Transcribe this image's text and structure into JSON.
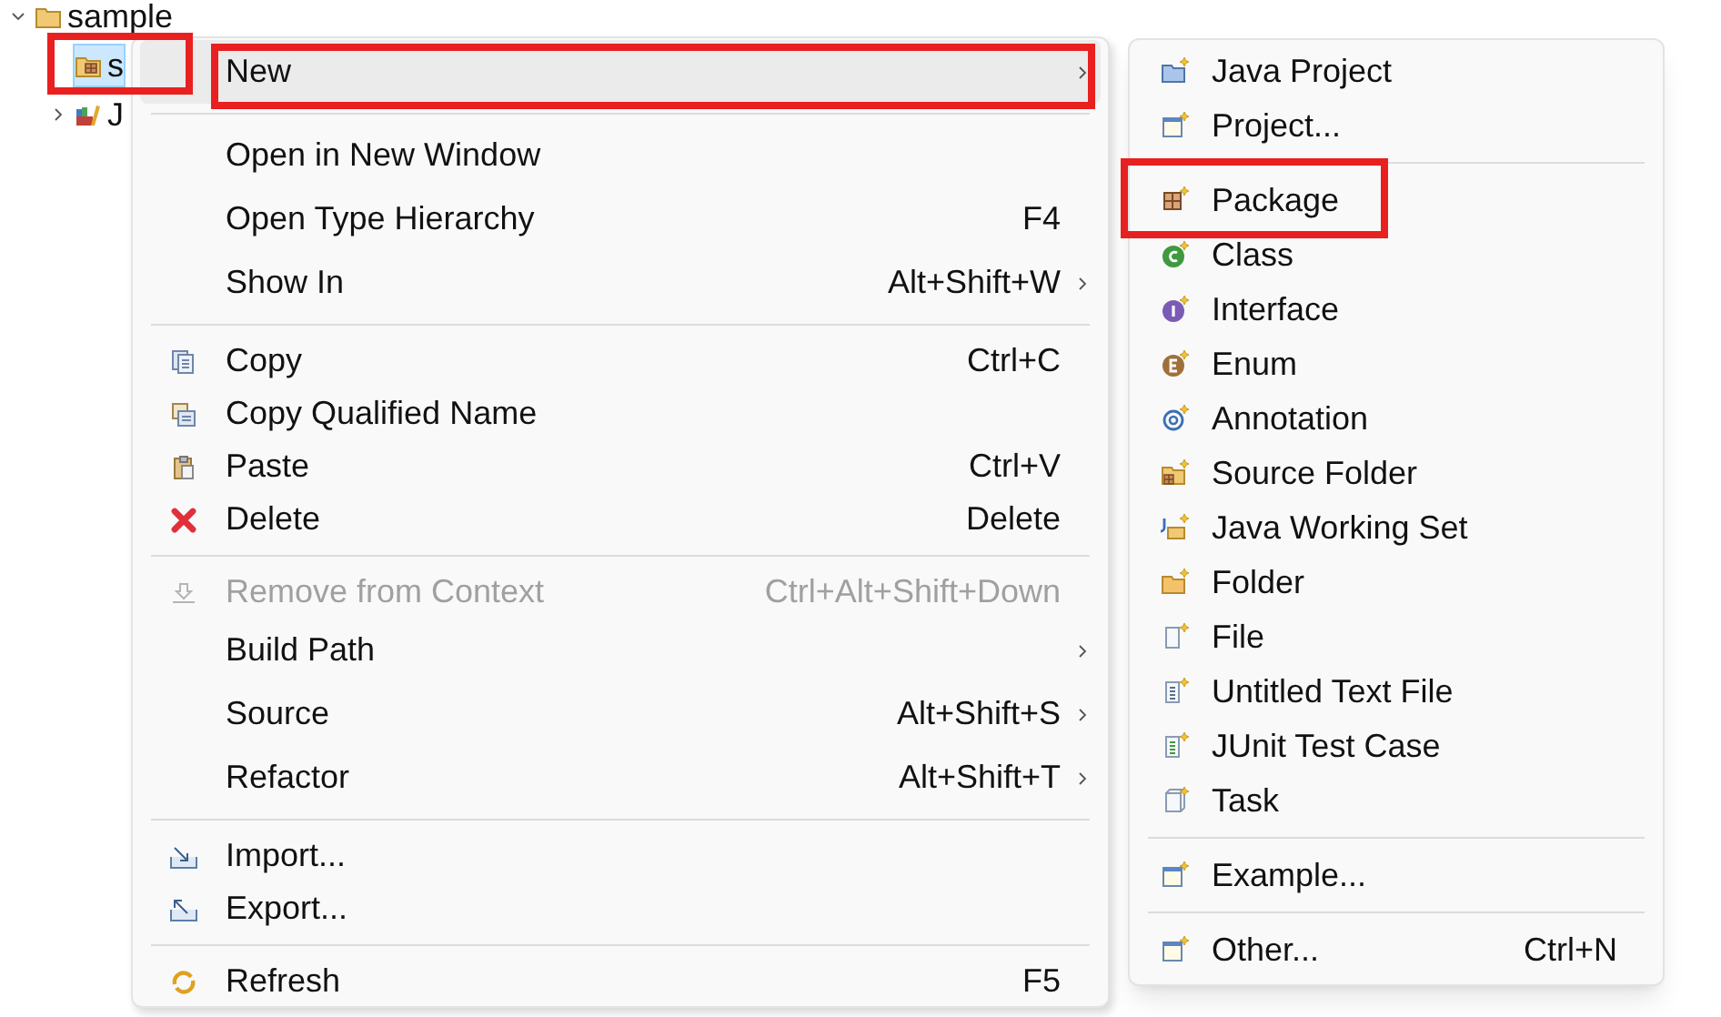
{
  "tree": {
    "items": [
      {
        "label": "sample",
        "expanded": true,
        "selected": false,
        "marked": false,
        "children": [
          {
            "label": "s",
            "selected": true,
            "marked": true
          },
          {
            "label": "J",
            "expanded": false,
            "selected": false,
            "marked": false
          }
        ]
      }
    ]
  },
  "context_menu": {
    "groups": [
      [
        {
          "label": "New",
          "has_submenu": true,
          "selected": true,
          "disabled": false,
          "marked": true
        }
      ],
      [
        {
          "label": "Open in New Window",
          "has_submenu": false,
          "selected": false,
          "disabled": false,
          "marked": false
        },
        {
          "label": "Open Type Hierarchy",
          "shortcut": "F4",
          "has_submenu": false,
          "selected": false,
          "disabled": false,
          "marked": false
        },
        {
          "label": "Show In",
          "shortcut": "Alt+Shift+W",
          "has_submenu": true,
          "selected": false,
          "disabled": false,
          "marked": false
        }
      ],
      [
        {
          "label": "Copy",
          "shortcut": "Ctrl+C",
          "has_submenu": false,
          "selected": false,
          "disabled": false,
          "marked": false
        },
        {
          "label": "Copy Qualified Name",
          "has_submenu": false,
          "selected": false,
          "disabled": false,
          "marked": false
        },
        {
          "label": "Paste",
          "shortcut": "Ctrl+V",
          "has_submenu": false,
          "selected": false,
          "disabled": false,
          "marked": false
        },
        {
          "label": "Delete",
          "shortcut": "Delete",
          "has_submenu": false,
          "selected": false,
          "disabled": false,
          "marked": false
        }
      ],
      [
        {
          "label": "Remove from Context",
          "shortcut": "Ctrl+Alt+Shift+Down",
          "has_submenu": false,
          "selected": false,
          "disabled": true,
          "marked": false
        },
        {
          "label": "Build Path",
          "has_submenu": true,
          "selected": false,
          "disabled": false,
          "marked": false
        },
        {
          "label": "Source",
          "shortcut": "Alt+Shift+S",
          "has_submenu": true,
          "selected": false,
          "disabled": false,
          "marked": false
        },
        {
          "label": "Refactor",
          "shortcut": "Alt+Shift+T",
          "has_submenu": true,
          "selected": false,
          "disabled": false,
          "marked": false
        }
      ],
      [
        {
          "label": "Import...",
          "has_submenu": false,
          "selected": false,
          "disabled": false,
          "marked": false
        },
        {
          "label": "Export...",
          "has_submenu": false,
          "selected": false,
          "disabled": false,
          "marked": false
        }
      ],
      [
        {
          "label": "Refresh",
          "shortcut": "F5",
          "has_submenu": false,
          "selected": false,
          "disabled": false,
          "marked": false
        }
      ]
    ]
  },
  "submenu": {
    "groups": [
      [
        {
          "label": "Java Project",
          "marked": false
        },
        {
          "label": "Project...",
          "marked": false
        }
      ],
      [
        {
          "label": "Package",
          "marked": true
        },
        {
          "label": "Class",
          "marked": false
        },
        {
          "label": "Interface",
          "marked": false
        },
        {
          "label": "Enum",
          "marked": false
        },
        {
          "label": "Annotation",
          "marked": false
        },
        {
          "label": "Source Folder",
          "marked": false
        },
        {
          "label": "Java Working Set",
          "marked": false
        },
        {
          "label": "Folder",
          "marked": false
        },
        {
          "label": "File",
          "marked": false
        },
        {
          "label": "Untitled Text File",
          "marked": false
        },
        {
          "label": "JUnit Test Case",
          "marked": false
        },
        {
          "label": "Task",
          "marked": false
        }
      ],
      [
        {
          "label": "Example...",
          "marked": false
        }
      ],
      [
        {
          "label": "Other...",
          "shortcut": "Ctrl+N",
          "marked": false
        }
      ]
    ]
  }
}
